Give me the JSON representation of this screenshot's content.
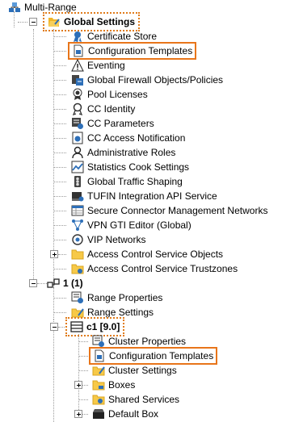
{
  "tree": {
    "root": {
      "label": "Multi-Range",
      "icon": "multi-range-icon"
    },
    "global_settings": {
      "label": "Global Settings",
      "icon": "open-folder-icon"
    },
    "global_items": [
      {
        "label": "Certificate Store",
        "icon": "certificate-icon"
      },
      {
        "label": "Configuration Templates",
        "icon": "document-icon"
      },
      {
        "label": "Eventing",
        "icon": "warning-icon"
      },
      {
        "label": "Global Firewall Objects/Policies",
        "icon": "firewall-objects-icon"
      },
      {
        "label": "Pool Licenses",
        "icon": "license-seal-icon"
      },
      {
        "label": "CC Identity",
        "icon": "identity-icon"
      },
      {
        "label": "CC Parameters",
        "icon": "parameters-icon"
      },
      {
        "label": "CC Access Notification",
        "icon": "access-notification-icon"
      },
      {
        "label": "Administrative Roles",
        "icon": "user-icon"
      },
      {
        "label": "Statistics Cook Settings",
        "icon": "statistics-icon"
      },
      {
        "label": "Global Traffic Shaping",
        "icon": "traffic-shaping-icon"
      },
      {
        "label": "TUFIN Integration API Service",
        "icon": "api-service-icon"
      },
      {
        "label": "Secure Connector Management Networks",
        "icon": "network-table-icon"
      },
      {
        "label": "VPN GTI Editor (Global)",
        "icon": "vpn-gti-icon"
      },
      {
        "label": "VIP Networks",
        "icon": "vip-networks-icon"
      },
      {
        "label": "Access Control Service Objects",
        "icon": "folder-icon"
      },
      {
        "label": "Access Control Service Trustzones",
        "icon": "folder-trustzones-icon"
      }
    ],
    "range": {
      "label": "1 (1)",
      "icon": "range-icon"
    },
    "range_items": [
      {
        "label": "Range Properties",
        "icon": "properties-icon"
      },
      {
        "label": "Range Settings",
        "icon": "settings-folder-icon"
      }
    ],
    "cluster": {
      "label": "c1 [9.0]",
      "icon": "cluster-icon"
    },
    "cluster_items": [
      {
        "label": "Cluster Properties",
        "icon": "properties-icon"
      },
      {
        "label": "Configuration Templates",
        "icon": "document-icon"
      },
      {
        "label": "Cluster Settings",
        "icon": "settings-folder-icon"
      },
      {
        "label": "Boxes",
        "icon": "boxes-folder-icon"
      },
      {
        "label": "Shared Services",
        "icon": "shared-services-icon"
      },
      {
        "label": "Default Box",
        "icon": "default-box-icon"
      }
    ]
  },
  "highlight_color": "#e8751a"
}
